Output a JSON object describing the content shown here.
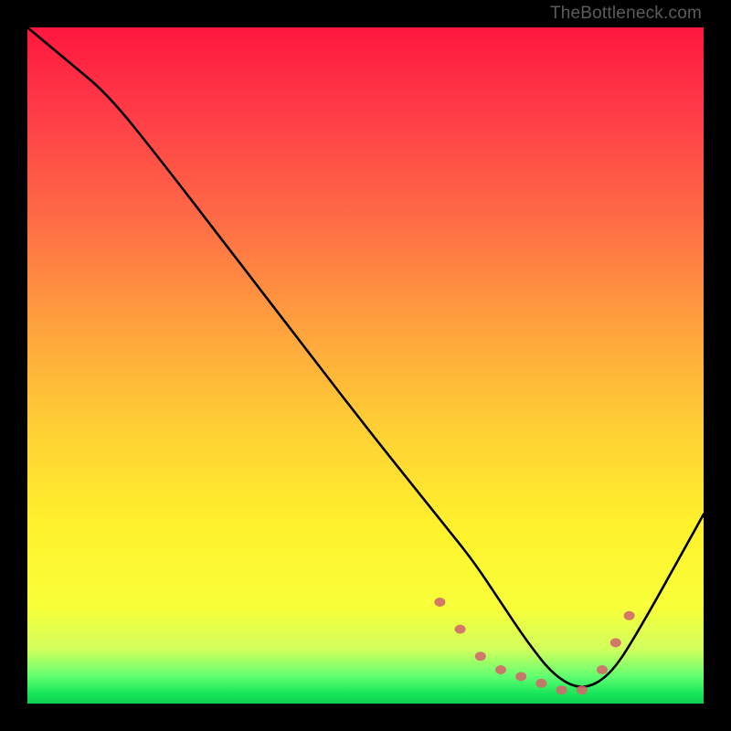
{
  "watermark": "TheBottleneck.com",
  "chart_data": {
    "type": "line",
    "title": "",
    "xlabel": "",
    "ylabel": "",
    "x_range_pct": [
      0,
      100
    ],
    "y_range_pct": [
      0,
      100
    ],
    "series": [
      {
        "name": "bottleneck-curve",
        "x_pct": [
          0,
          6,
          12,
          20,
          30,
          40,
          50,
          58,
          62,
          66,
          70,
          74,
          78,
          82,
          86,
          90,
          100
        ],
        "y_pct": [
          100,
          95,
          90,
          80,
          67,
          54,
          41,
          31,
          26,
          21,
          15,
          9,
          4,
          2,
          4,
          10,
          28
        ],
        "note": "y_pct is approximate height of the curve from the bottom of the plot, read from the gradient bands; minimum (≈2%) sits around x≈80–82%."
      }
    ],
    "markers": {
      "name": "flat-region-dots",
      "color": "#d06a6a",
      "x_pct": [
        61,
        64,
        67,
        70,
        73,
        76,
        79,
        82,
        85,
        87,
        89
      ],
      "y_pct": [
        15,
        11,
        7,
        5,
        4,
        3,
        2,
        2,
        5,
        9,
        13
      ]
    },
    "background_gradient_stops": [
      {
        "pct": 0,
        "color": "#ff173f"
      },
      {
        "pct": 50,
        "color": "#ffb63a"
      },
      {
        "pct": 85,
        "color": "#fbff34"
      },
      {
        "pct": 96,
        "color": "#60ff70"
      },
      {
        "pct": 100,
        "color": "#0ccf4e"
      }
    ]
  }
}
